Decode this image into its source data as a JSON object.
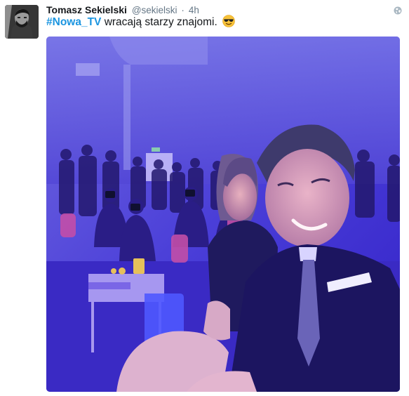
{
  "tweet": {
    "author": {
      "display_name": "Tomasz Sekielski",
      "screen_name": "@sekielski"
    },
    "separator": "·",
    "timestamp": "4h",
    "text": {
      "hashtag": "#Nowa_TV",
      "body": " wracają starzy znajomi."
    },
    "icons": {
      "visibility": "globe-icon",
      "emoji": "smiling-face-with-sunglasses"
    },
    "colors": {
      "link": "#1b95e0",
      "name": "#14171a",
      "muted": "#657786",
      "photo_tint": "#4a33d6"
    }
  }
}
